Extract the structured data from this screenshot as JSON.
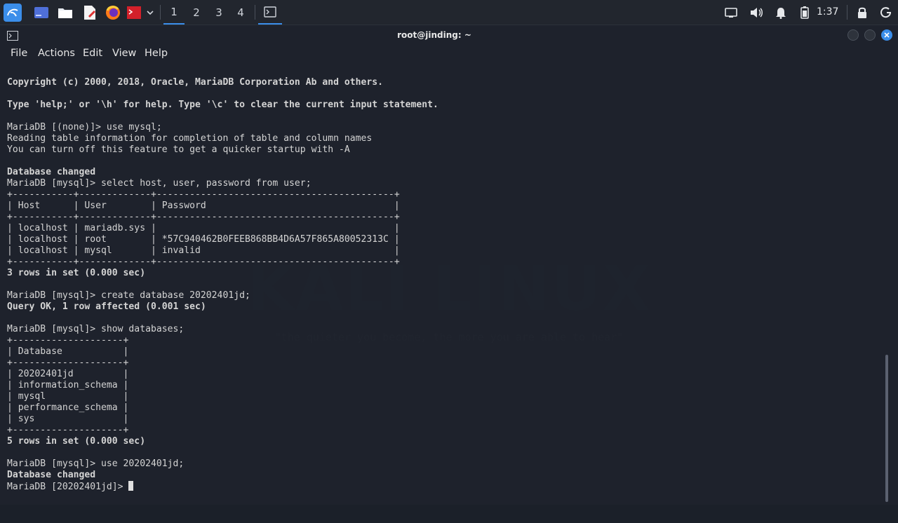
{
  "taskbar": {
    "workspaces": [
      "1",
      "2",
      "3",
      "4"
    ],
    "active_workspace": "1",
    "clock": "1:37",
    "icons": [
      "kali-menu-icon",
      "desktop-icon",
      "file-manager-icon",
      "text-editor-icon",
      "firefox-icon",
      "terminal-red-icon",
      "dropdown-icon",
      "terminal-task-icon",
      "display-icon",
      "volume-icon",
      "notification-bell-icon",
      "battery-icon",
      "lock-icon",
      "power-icon"
    ]
  },
  "window": {
    "title": "root@jinding: ~",
    "menu": [
      "File",
      "Actions",
      "Edit",
      "View",
      "Help"
    ]
  },
  "wallpaper": {
    "logo": "KALI LINUX",
    "tagline": "\"the quieter you become, the more you are able to hear\""
  },
  "terminal": {
    "lines": [
      {
        "text": "Copyright (c) 2000, 2018, Oracle, MariaDB Corporation Ab and others.",
        "bold": true
      },
      {
        "text": "",
        "bold": false
      },
      {
        "text": "Type 'help;' or '\\h' for help. Type '\\c' to clear the current input statement.",
        "bold": true
      },
      {
        "text": "",
        "bold": false
      },
      {
        "text": "MariaDB [(none)]> use mysql;",
        "bold": false
      },
      {
        "text": "Reading table information for completion of table and column names",
        "bold": false
      },
      {
        "text": "You can turn off this feature to get a quicker startup with -A",
        "bold": false
      },
      {
        "text": "",
        "bold": false
      },
      {
        "text": "Database changed",
        "bold": true
      },
      {
        "text": "MariaDB [mysql]> select host, user, password from user;",
        "bold": false
      },
      {
        "text": "+-----------+-------------+-------------------------------------------+",
        "bold": false
      },
      {
        "text": "| Host      | User        | Password                                  |",
        "bold": false
      },
      {
        "text": "+-----------+-------------+-------------------------------------------+",
        "bold": false
      },
      {
        "text": "| localhost | mariadb.sys |                                           |",
        "bold": false
      },
      {
        "text": "| localhost | root        | *57C940462B0FEEB868BB4D6A57F865A80052313C |",
        "bold": false
      },
      {
        "text": "| localhost | mysql       | invalid                                   |",
        "bold": false
      },
      {
        "text": "+-----------+-------------+-------------------------------------------+",
        "bold": false
      },
      {
        "text": "3 rows in set (0.000 sec)",
        "bold": true
      },
      {
        "text": "",
        "bold": false
      },
      {
        "text": "MariaDB [mysql]> create database 20202401jd;",
        "bold": false
      },
      {
        "text": "Query OK, 1 row affected (0.001 sec)",
        "bold": true
      },
      {
        "text": "",
        "bold": false
      },
      {
        "text": "MariaDB [mysql]> show databases;",
        "bold": false
      },
      {
        "text": "+--------------------+",
        "bold": false
      },
      {
        "text": "| Database           |",
        "bold": false
      },
      {
        "text": "+--------------------+",
        "bold": false
      },
      {
        "text": "| 20202401jd         |",
        "bold": false
      },
      {
        "text": "| information_schema |",
        "bold": false
      },
      {
        "text": "| mysql              |",
        "bold": false
      },
      {
        "text": "| performance_schema |",
        "bold": false
      },
      {
        "text": "| sys                |",
        "bold": false
      },
      {
        "text": "+--------------------+",
        "bold": false
      },
      {
        "text": "5 rows in set (0.000 sec)",
        "bold": true
      },
      {
        "text": "",
        "bold": false
      },
      {
        "text": "MariaDB [mysql]> use 20202401jd;",
        "bold": false
      },
      {
        "text": "Database changed",
        "bold": true
      }
    ],
    "prompt": "MariaDB [20202401jd]> "
  }
}
